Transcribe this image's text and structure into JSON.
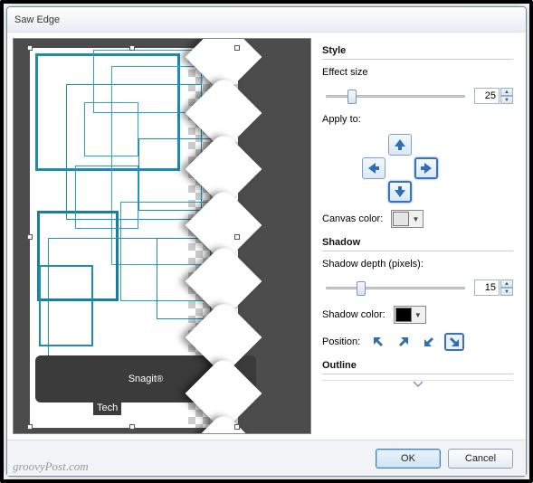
{
  "window": {
    "title": "Saw Edge"
  },
  "preview": {
    "logo_text": "Snagit",
    "logo_sub": "Tech"
  },
  "style": {
    "heading": "Style",
    "effect_size_label": "Effect size",
    "effect_size_value": "25",
    "apply_to_label": "Apply to:",
    "canvas_color_label": "Canvas color:",
    "canvas_color": "#e5e5e5"
  },
  "shadow": {
    "heading": "Shadow",
    "depth_label": "Shadow depth (pixels):",
    "depth_value": "15",
    "color_label": "Shadow color:",
    "color": "#000000",
    "position_label": "Position:"
  },
  "outline": {
    "heading": "Outline"
  },
  "buttons": {
    "ok": "OK",
    "cancel": "Cancel"
  },
  "watermark": "groovyPost.com"
}
